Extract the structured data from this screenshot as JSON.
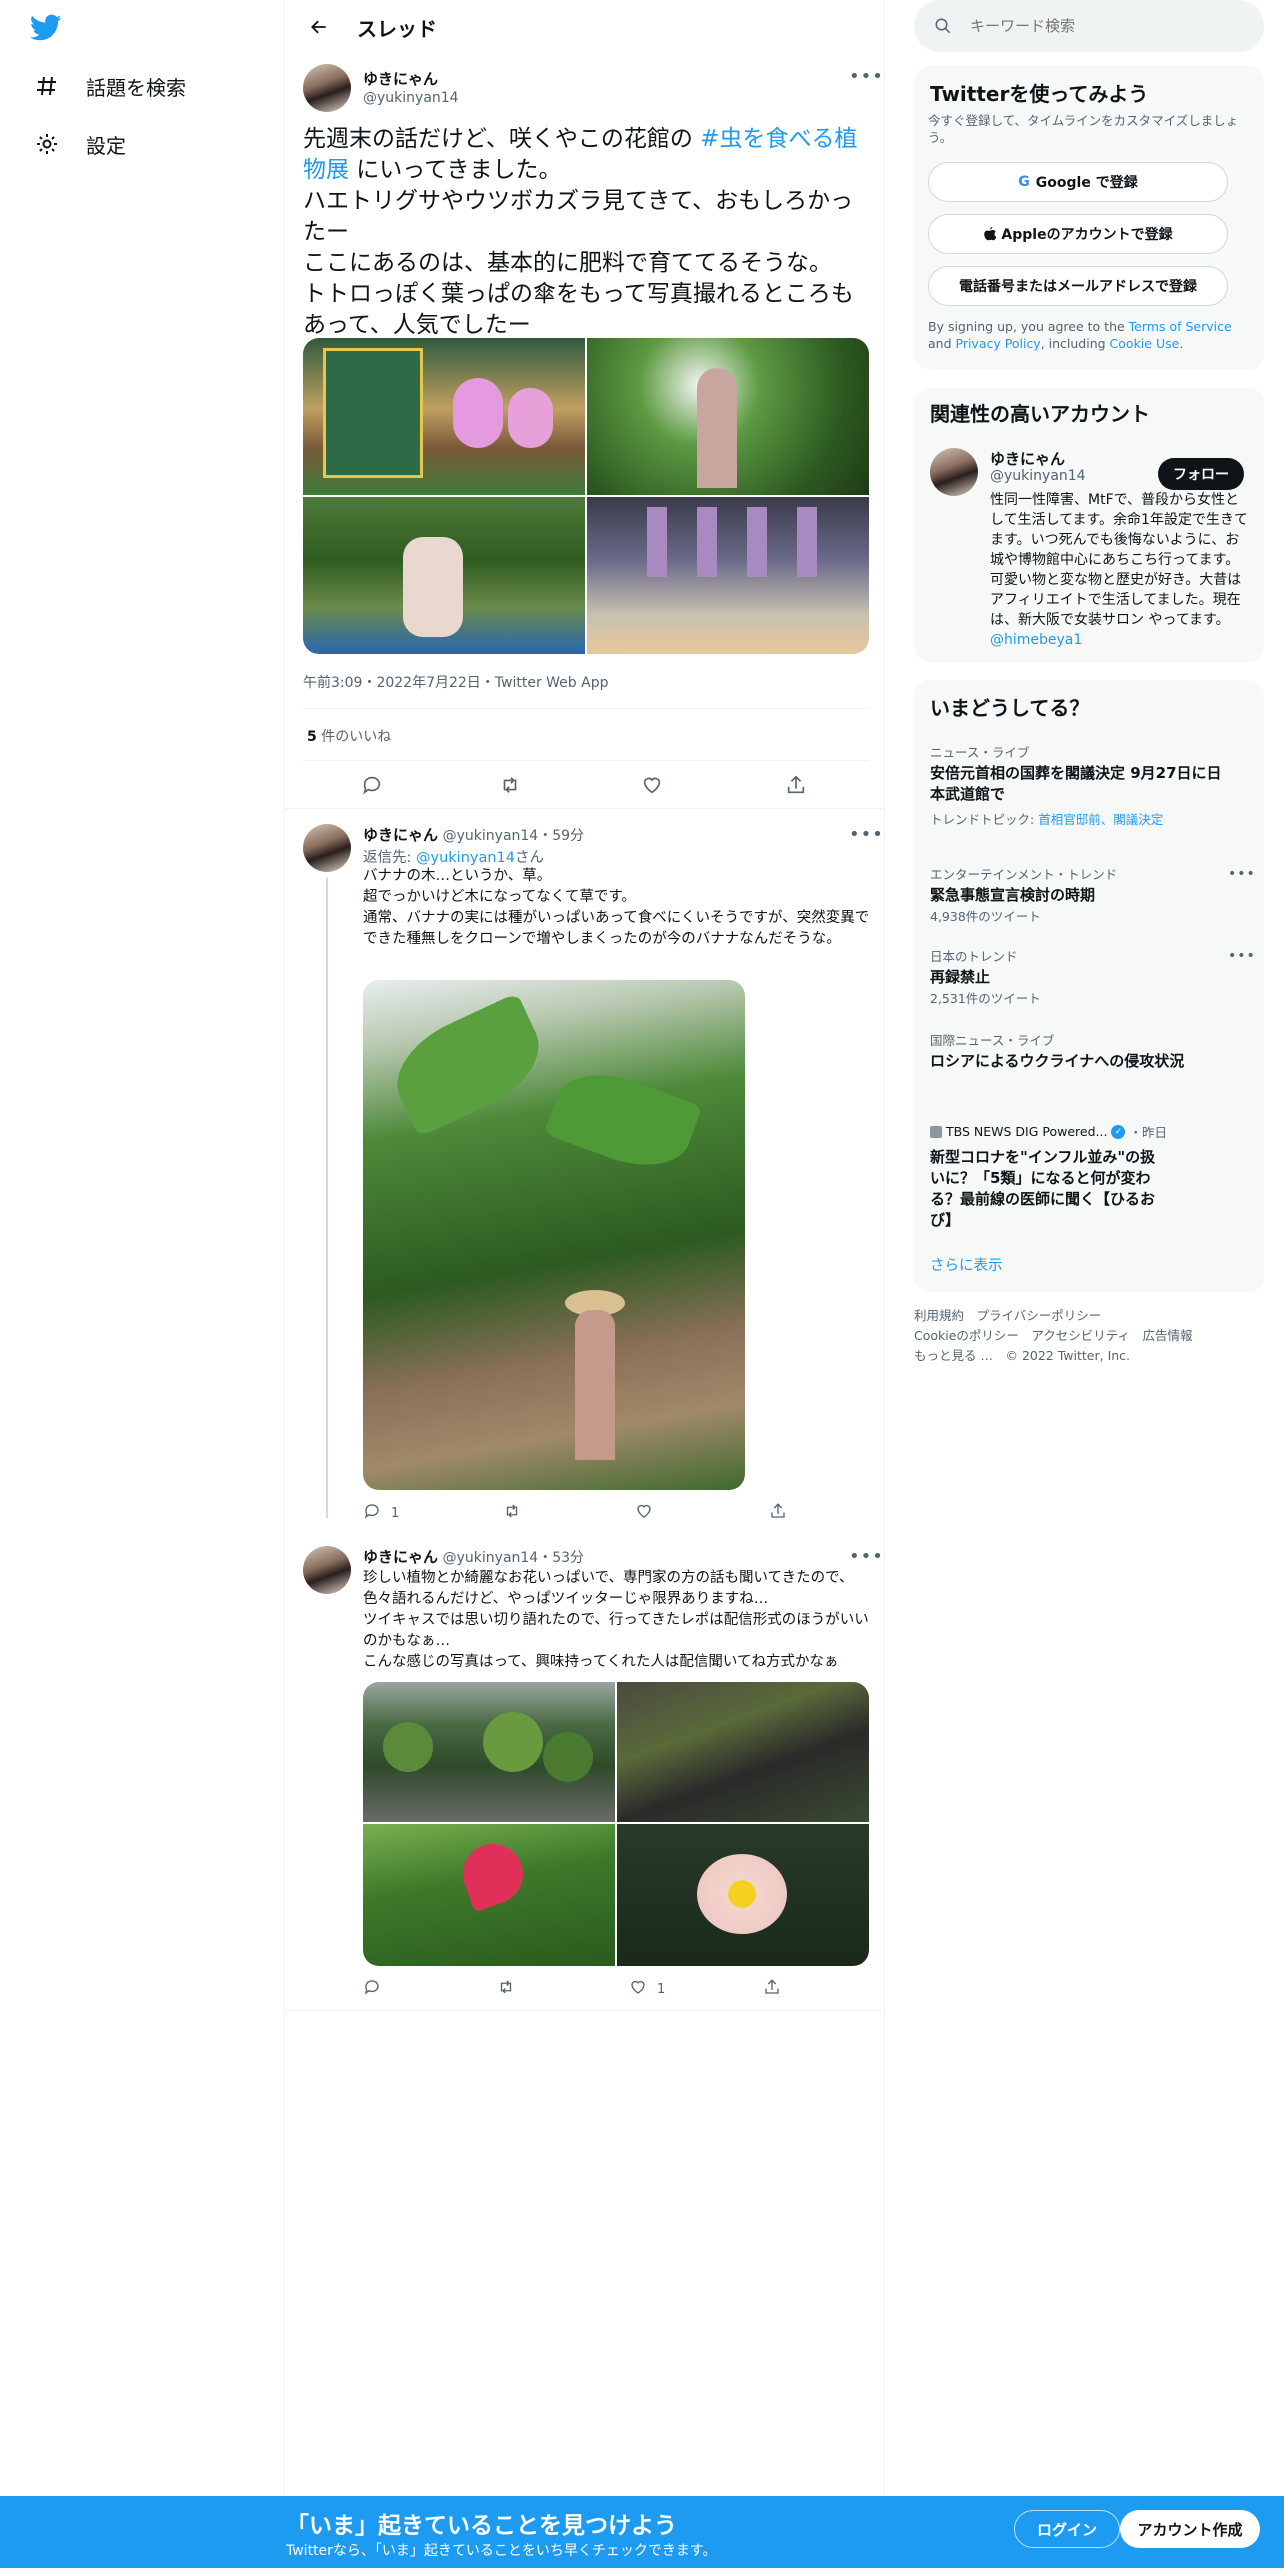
{
  "nav": {
    "explore_label": "話題を検索",
    "settings_label": "設定"
  },
  "header": {
    "title": "スレッド"
  },
  "main_tweet": {
    "name": "ゆきにゃん",
    "handle": "@yukinyan14",
    "text_before": "先週末の話だけど、咲くやこの花館の ",
    "hashtag": "#虫を食べる植物展",
    "text_after": " にいってきました。\nハエトリグサやウツボカズラ見てきて、おもしろかったー\nここにあるのは、基本的に肥料で育ててるそうな。\nトトロっぽく葉っぱの傘をもって写真撮れるところもあって、人気でしたー",
    "timestamp": "午前3:09・2022年7月22日・Twitter Web App",
    "likes_count": "5",
    "likes_label": " 件のいいね"
  },
  "reply1": {
    "name": "ゆきにゃん",
    "handle": "@yukinyan14",
    "time": "・59分",
    "reply_prefix": "返信先: ",
    "reply_to": "@yukinyan14",
    "reply_suffix": "さん",
    "text": "バナナの木…というか、草。\n超でっかいけど木になってなくて草です。\n通常、バナナの実には種がいっぱいあって食べにくいそうですが、突然変異でできた種無しをクローンで増やしまくったのが今のバナナなんだそうな。",
    "reply_count": "1"
  },
  "reply2": {
    "name": "ゆきにゃん",
    "handle": "@yukinyan14",
    "time": "・53分",
    "text": "珍しい植物とか綺麗なお花いっぱいで、専門家の方の話も聞いてきたので、色々語れるんだけど、やっぱツイッターじゃ限界ありますね…\nツイキャスでは思い切り語れたので、行ってきたレポは配信形式のほうがいいのかもなぁ…\nこんな感じの写真はって、興味持ってくれた人は配信聞いてね方式かなぁ",
    "like_count": "1"
  },
  "search": {
    "placeholder": "キーワード検索"
  },
  "signup_card": {
    "title": "Twitterを使ってみよう",
    "subtitle": "今すぐ登録して、タイムラインをカスタマイズしましょう。",
    "google_label": "Google で登録",
    "apple_label": "Appleのアカウントで登録",
    "phone_label": "電話番号またはメールアドレスで登録",
    "terms_1": "By signing up, you agree to the ",
    "terms_link": "Terms of Service",
    "terms_2": " and ",
    "privacy_link": "Privacy Policy",
    "terms_3": ", including ",
    "cookie_link": "Cookie Use",
    "terms_4": "."
  },
  "related_card": {
    "title": "関連性の高いアカウント",
    "name": "ゆきにゃん",
    "handle": "@yukinyan14",
    "follow_label": "フォロー",
    "bio": "性同一性障害、MtFで、普段から女性として生活してます。余命1年設定で生きてます。いつ死んでも後悔ないように、お城や博物館中心にあちこち行ってます。可愛い物と変な物と歴史が好き。大昔はアフィリエイトで生活してました。現在は、新大阪で女装サロン やってます。",
    "bio_link": "@himebeya1"
  },
  "trends_card": {
    "title": "いまどうしてる？",
    "items": [
      {
        "category": "ニュース・ライブ",
        "title": "安倍元首相の国葬を閣議決定 9月27日に日本武道館で",
        "sub_prefix": "トレンドトピック: ",
        "sub_links": "首相官邸前、閣議決定"
      },
      {
        "category": "エンターテインメント・トレンド",
        "title": "緊急事態宣言検討の時期",
        "count": "4,938件のツイート"
      },
      {
        "category": "日本のトレンド",
        "title": "再録禁止",
        "count": "2,531件のツイート"
      },
      {
        "category": "国際ニュース・ライブ",
        "title": "ロシアによるウクライナへの侵攻状況"
      },
      {
        "source": "TBS NEWS DIG Powered...",
        "time": "・昨日",
        "title": "新型コロナを\"インフル並み\"の扱いに？「5類」になると何が変わる？最前線の医師に聞く【ひるおび】"
      }
    ],
    "show_more": "さらに表示"
  },
  "footer": {
    "line1": "利用規約　プライバシーポリシー",
    "line2": "Cookieのポリシー　アクセシビリティ　広告情報",
    "line3": "もっと見る …　© 2022 Twitter, Inc."
  },
  "bottom_bar": {
    "title": "「いま」起きていることを見つけよう",
    "subtitle": "Twitterなら、「いま」起きていることをいち早くチェックできます。",
    "login_label": "ログイン",
    "signup_label": "アカウント作成"
  },
  "colors": {
    "accent": "#1d9bf0",
    "text": "#0f1419",
    "muted": "#536471"
  }
}
